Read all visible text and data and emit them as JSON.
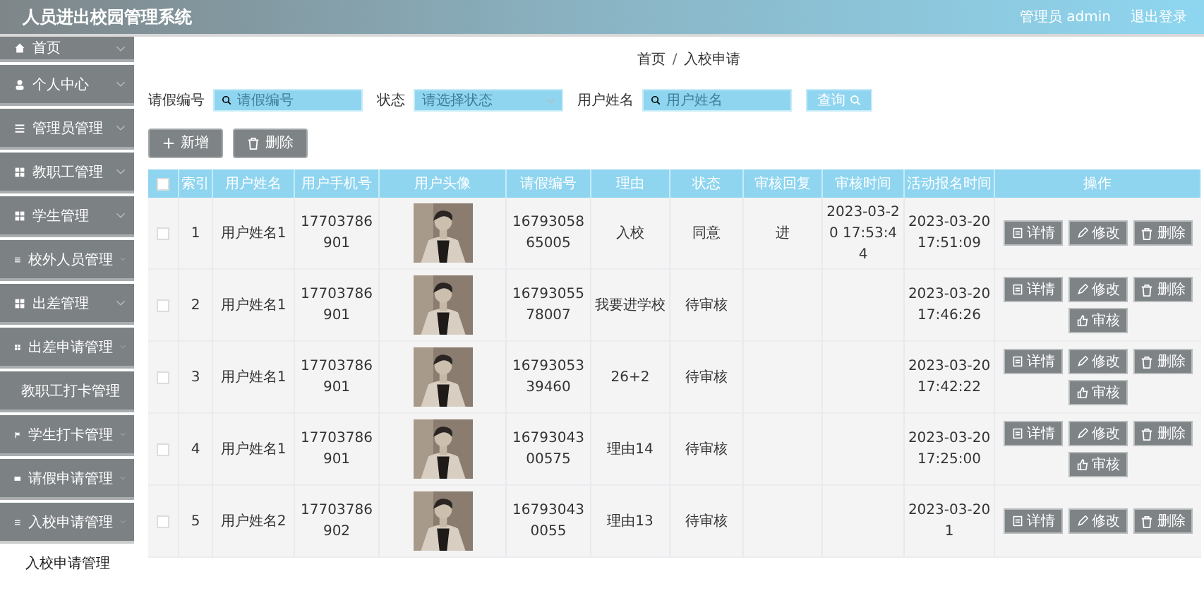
{
  "header": {
    "title": "人员进出校园管理系统",
    "user": "管理员 admin",
    "logout": "退出登录"
  },
  "sidebar": {
    "items": [
      {
        "label": "首页",
        "expanded": false
      },
      {
        "label": "个人中心",
        "expanded": false
      },
      {
        "label": "管理员管理",
        "expanded": false
      },
      {
        "label": "教职工管理",
        "expanded": false
      },
      {
        "label": "学生管理",
        "expanded": false
      },
      {
        "label": "校外人员管理",
        "expanded": false
      },
      {
        "label": "出差管理",
        "expanded": false
      },
      {
        "label": "出差申请管理",
        "expanded": false
      },
      {
        "label": "教职工打卡管理",
        "expanded": false
      },
      {
        "label": "学生打卡管理",
        "expanded": false
      },
      {
        "label": "请假申请管理",
        "expanded": false
      },
      {
        "label": "入校申请管理",
        "expanded": true,
        "children": [
          {
            "label": "入校申请管理",
            "selected": true
          }
        ]
      }
    ]
  },
  "breadcrumb": {
    "items": [
      "首页",
      "入校申请"
    ],
    "separator": "/"
  },
  "search": {
    "fields": [
      {
        "label": "请假编号",
        "placeholder": "请假编号",
        "kind": "input"
      },
      {
        "label": "状态",
        "placeholder": "请选择状态",
        "kind": "select"
      },
      {
        "label": "用户姓名",
        "placeholder": "用户姓名",
        "kind": "input"
      }
    ],
    "button": "查询"
  },
  "toolbar": [
    {
      "label": "新增",
      "kind": "add"
    },
    {
      "label": "删除",
      "kind": "delete"
    }
  ],
  "table": {
    "select_all_checked": false,
    "columns": [
      "索引",
      "用户姓名",
      "用户手机号",
      "用户头像",
      "请假编号",
      "理由",
      "状态",
      "审核回复",
      "审核时间",
      "活动报名时间",
      "操作"
    ],
    "rows": [
      {
        "checked": false,
        "index": "1",
        "name": "用户姓名1",
        "phone": "17703786901",
        "avatar": {
          "kind": "picture"
        },
        "code": "1679305865005",
        "reason": "入校",
        "status": "同意",
        "reply": "进",
        "audit_time": "2023-03-20 17:53:44",
        "time": "2023-03-20 17:51:09",
        "actions": [
          {
            "label": "详情",
            "kind": "detail"
          },
          {
            "label": "修改",
            "kind": "edit"
          },
          {
            "label": "删除",
            "kind": "delete"
          }
        ]
      },
      {
        "checked": false,
        "index": "2",
        "name": "用户姓名1",
        "phone": "17703786901",
        "avatar": {
          "kind": "picture"
        },
        "code": "1679305578007",
        "reason": "我要进学校",
        "status": "待审核",
        "time": "2023-03-20 17:46:26",
        "actions": [
          {
            "label": "详情",
            "kind": "detail"
          },
          {
            "label": "修改",
            "kind": "edit"
          },
          {
            "label": "删除",
            "kind": "delete"
          },
          {
            "label": "审核",
            "kind": "audit"
          }
        ]
      },
      {
        "checked": false,
        "index": "3",
        "name": "用户姓名1",
        "phone": "17703786901",
        "avatar": {
          "kind": "picture"
        },
        "code": "1679305339460",
        "reason": "26+2",
        "status": "待审核",
        "time": "2023-03-20 17:42:22",
        "actions": [
          {
            "label": "详情",
            "kind": "detail"
          },
          {
            "label": "修改",
            "kind": "edit"
          },
          {
            "label": "删除",
            "kind": "delete"
          },
          {
            "label": "审核",
            "kind": "audit"
          }
        ]
      },
      {
        "checked": false,
        "index": "4",
        "name": "用户姓名1",
        "phone": "17703786901",
        "avatar": {
          "kind": "picture"
        },
        "code": "1679304300575",
        "reason": "理由14",
        "status": "待审核",
        "time": "2023-03-20 17:25:00",
        "actions": [
          {
            "label": "详情",
            "kind": "detail"
          },
          {
            "label": "修改",
            "kind": "edit"
          },
          {
            "label": "删除",
            "kind": "delete"
          },
          {
            "label": "审核",
            "kind": "audit"
          }
        ]
      },
      {
        "checked": false,
        "index": "5",
        "name": "用户姓名2",
        "phone": "17703786902",
        "avatar": {
          "kind": "picture"
        },
        "code": "167930430055",
        "reason": "理由13",
        "status": "待审核",
        "time": "2023-03-20 1",
        "actions": [
          {
            "label": "详情",
            "kind": "detail"
          },
          {
            "label": "修改",
            "kind": "edit"
          },
          {
            "label": "删除",
            "kind": "delete"
          }
        ]
      }
    ]
  }
}
